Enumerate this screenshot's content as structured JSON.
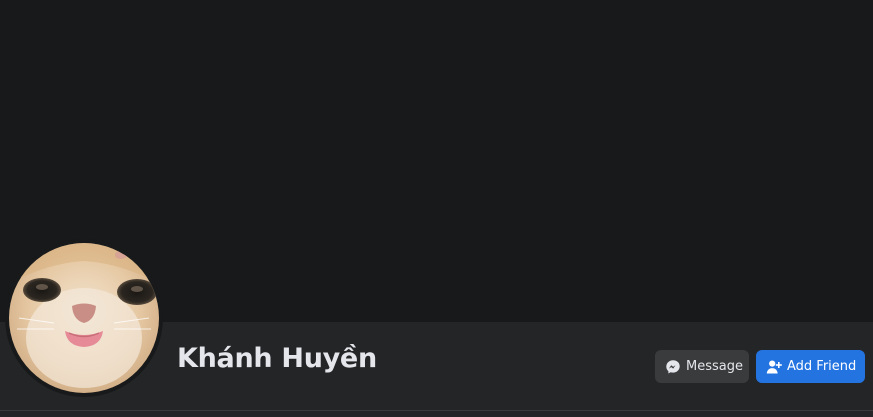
{
  "profile": {
    "name": "Khánh Huyền",
    "avatar_alt": "cat photo with tongue out"
  },
  "actions": {
    "message_label": "Message",
    "message_icon": "messenger-icon",
    "add_friend_label": "Add Friend",
    "add_friend_icon": "add-person-icon"
  },
  "colors": {
    "background": "#18191a",
    "info_bar": "#242526",
    "secondary_button": "#3a3b3c",
    "primary_button": "#2374e1",
    "text": "#e4e6eb"
  }
}
